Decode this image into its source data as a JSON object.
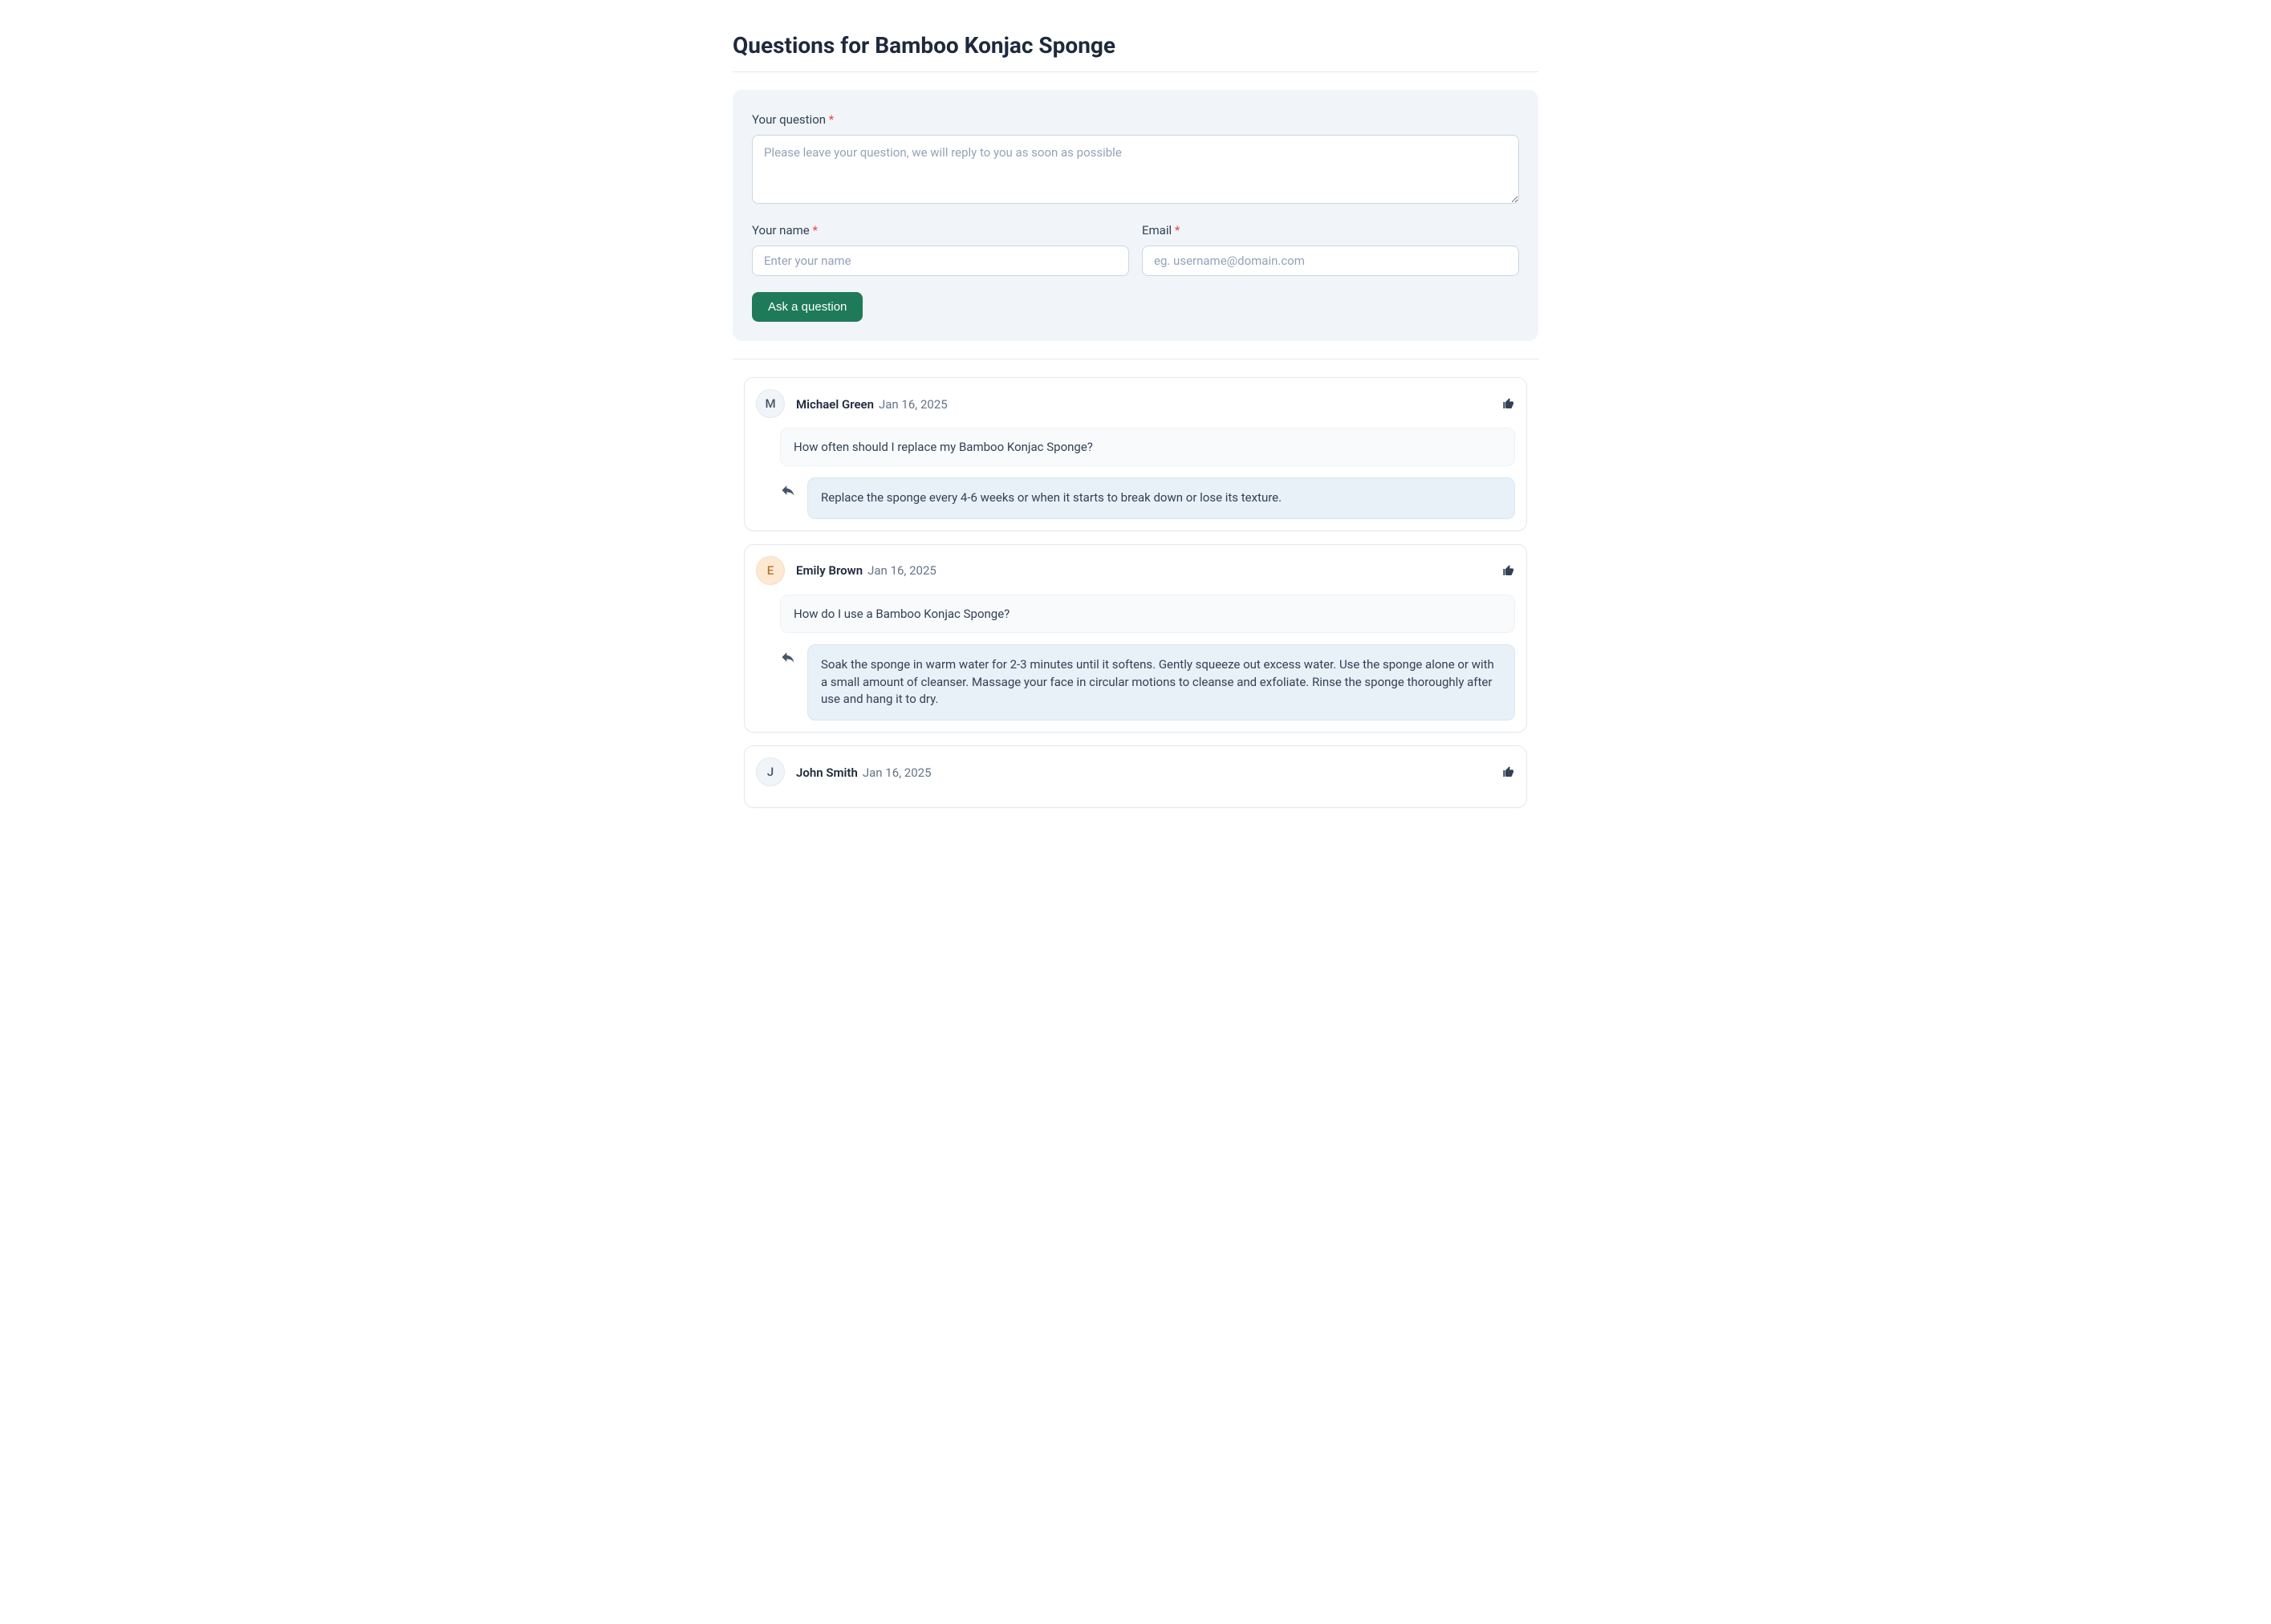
{
  "page": {
    "title": "Questions for Bamboo Konjac Sponge"
  },
  "form": {
    "question_label": "Your question",
    "question_placeholder": "Please leave your question, we will reply to you as soon as possible",
    "name_label": "Your name",
    "name_placeholder": "Enter your name",
    "email_label": "Email",
    "email_placeholder": "eg. username@domain.com",
    "submit_label": "Ask a question",
    "required_marker": "*"
  },
  "questions": [
    {
      "initial": "M",
      "avatar_class": "avatar-gray",
      "author": "Michael Green",
      "date": "Jan 16, 2025",
      "question": "How often should I replace my Bamboo Konjac Sponge?",
      "answer": "Replace the sponge every 4-6 weeks or when it starts to break down or lose its texture."
    },
    {
      "initial": "E",
      "avatar_class": "avatar-peach",
      "author": "Emily Brown",
      "date": "Jan 16, 2025",
      "question": "How do I use a Bamboo Konjac Sponge?",
      "answer": "Soak the sponge in warm water for 2-3 minutes until it softens. Gently squeeze out excess water. Use the sponge alone or with a small amount of cleanser. Massage your face in circular motions to cleanse and exfoliate. Rinse the sponge thoroughly after use and hang it to dry."
    },
    {
      "initial": "J",
      "avatar_class": "avatar-gray",
      "author": "John Smith",
      "date": "Jan 16, 2025",
      "question": "",
      "answer": ""
    }
  ]
}
